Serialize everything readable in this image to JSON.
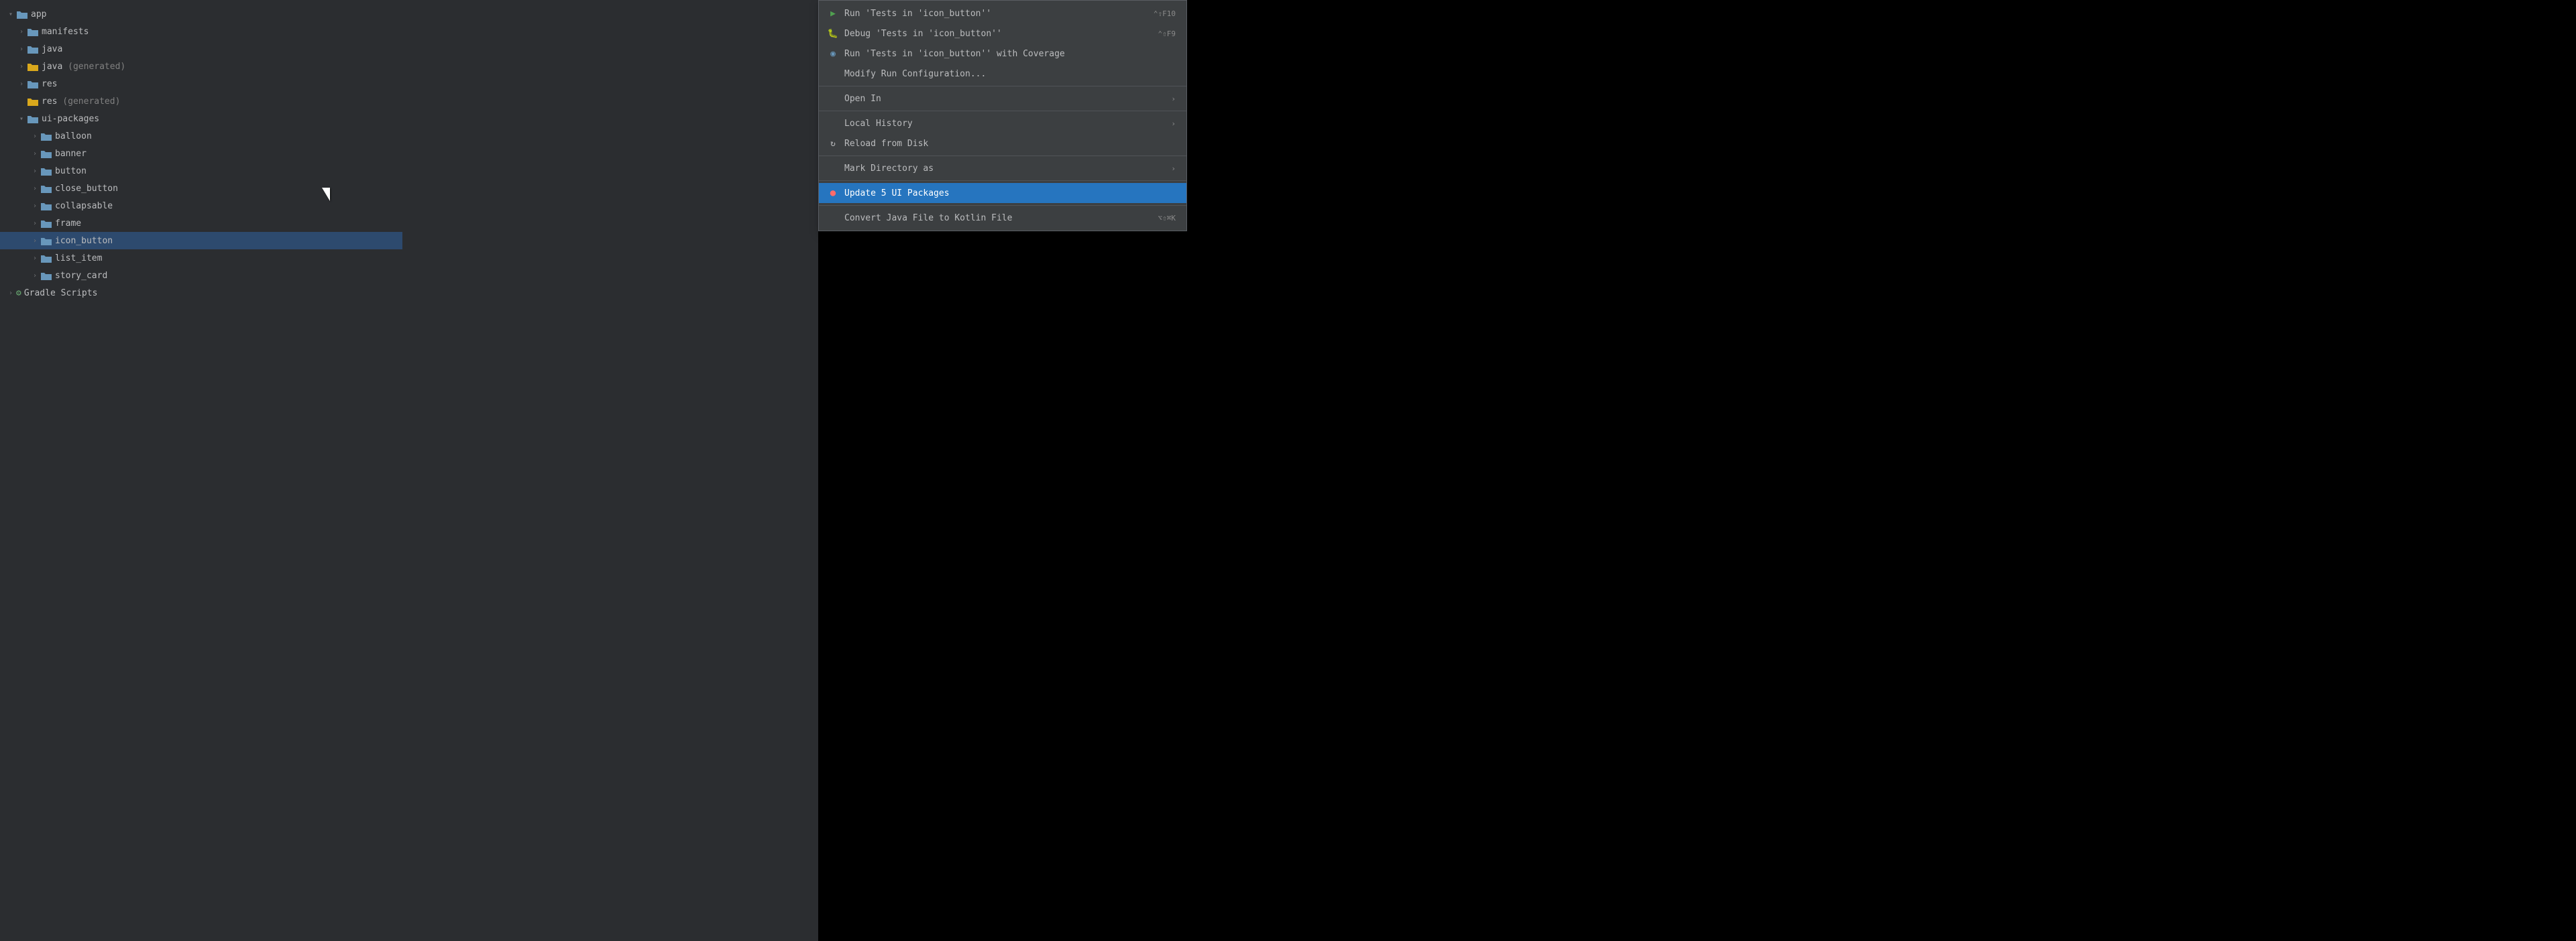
{
  "fileTree": {
    "items": [
      {
        "id": "app",
        "label": "app",
        "level": 0,
        "type": "folder-open",
        "color": "blue",
        "expanded": true,
        "indent": 0
      },
      {
        "id": "manifests",
        "label": "manifests",
        "level": 1,
        "type": "folder",
        "color": "blue",
        "expanded": false,
        "indent": 1
      },
      {
        "id": "java",
        "label": "java",
        "level": 1,
        "type": "folder",
        "color": "blue",
        "expanded": false,
        "indent": 1
      },
      {
        "id": "java-gen",
        "label": "java",
        "labelExtra": " (generated)",
        "level": 1,
        "type": "folder",
        "color": "yellow",
        "expanded": false,
        "indent": 1
      },
      {
        "id": "res",
        "label": "res",
        "level": 1,
        "type": "folder",
        "color": "blue",
        "expanded": false,
        "indent": 1
      },
      {
        "id": "res-gen",
        "label": "res",
        "labelExtra": " (generated)",
        "level": 1,
        "type": "folder",
        "color": "yellow",
        "expanded": false,
        "indent": 1,
        "noChevron": true
      },
      {
        "id": "ui-packages",
        "label": "ui-packages",
        "level": 1,
        "type": "folder-open",
        "color": "blue",
        "expanded": true,
        "indent": 1
      },
      {
        "id": "balloon",
        "label": "balloon",
        "level": 2,
        "type": "folder",
        "color": "blue",
        "expanded": false,
        "indent": 2
      },
      {
        "id": "banner",
        "label": "banner",
        "level": 2,
        "type": "folder",
        "color": "blue",
        "expanded": false,
        "indent": 2
      },
      {
        "id": "button",
        "label": "button",
        "level": 2,
        "type": "folder",
        "color": "blue",
        "expanded": false,
        "indent": 2
      },
      {
        "id": "close_button",
        "label": "close_button",
        "level": 2,
        "type": "folder",
        "color": "blue",
        "expanded": false,
        "indent": 2
      },
      {
        "id": "collapsable",
        "label": "collapsable",
        "level": 2,
        "type": "folder",
        "color": "blue",
        "expanded": false,
        "indent": 2
      },
      {
        "id": "frame",
        "label": "frame",
        "level": 2,
        "type": "folder",
        "color": "blue",
        "expanded": false,
        "indent": 2
      },
      {
        "id": "icon_button",
        "label": "icon_button",
        "level": 2,
        "type": "folder",
        "color": "blue",
        "expanded": false,
        "indent": 2,
        "selected": true
      },
      {
        "id": "list_item",
        "label": "list_item",
        "level": 2,
        "type": "folder",
        "color": "blue",
        "expanded": false,
        "indent": 2
      },
      {
        "id": "story_card",
        "label": "story_card",
        "level": 2,
        "type": "folder",
        "color": "blue",
        "expanded": false,
        "indent": 2
      },
      {
        "id": "gradle",
        "label": "Gradle Scripts",
        "level": 0,
        "type": "gradle",
        "indent": 0,
        "noChevron": false
      }
    ]
  },
  "contextMenu": {
    "items": [
      {
        "id": "run",
        "label": "Run 'Tests in 'icon_button''",
        "shortcut": "⌃⇧F10",
        "icon": "run",
        "type": "action"
      },
      {
        "id": "debug",
        "label": "Debug 'Tests in 'icon_button''",
        "shortcut": "⌃⇧F9",
        "icon": "debug",
        "type": "action"
      },
      {
        "id": "coverage",
        "label": "Run 'Tests in 'icon_button'' with Coverage",
        "shortcut": "",
        "icon": "coverage",
        "type": "action"
      },
      {
        "id": "modify-run",
        "label": "Modify Run Configuration...",
        "shortcut": "",
        "icon": "none",
        "type": "action"
      },
      {
        "id": "sep1",
        "type": "separator"
      },
      {
        "id": "open-in",
        "label": "Open In",
        "shortcut": "",
        "icon": "none",
        "type": "submenu"
      },
      {
        "id": "sep2",
        "type": "separator"
      },
      {
        "id": "local-history",
        "label": "Local History",
        "shortcut": "",
        "icon": "none",
        "type": "submenu"
      },
      {
        "id": "reload",
        "label": "Reload from Disk",
        "shortcut": "",
        "icon": "reload",
        "type": "action"
      },
      {
        "id": "sep3",
        "type": "separator"
      },
      {
        "id": "mark-dir",
        "label": "Mark Directory as",
        "shortcut": "",
        "icon": "none",
        "type": "submenu"
      },
      {
        "id": "sep4",
        "type": "separator"
      },
      {
        "id": "update",
        "label": "Update 5 UI Packages",
        "shortcut": "",
        "icon": "update",
        "type": "action",
        "active": true
      },
      {
        "id": "sep5",
        "type": "separator"
      },
      {
        "id": "convert",
        "label": "Convert Java File to Kotlin File",
        "shortcut": "⌥⇧⌘K",
        "icon": "none",
        "type": "action"
      }
    ]
  }
}
